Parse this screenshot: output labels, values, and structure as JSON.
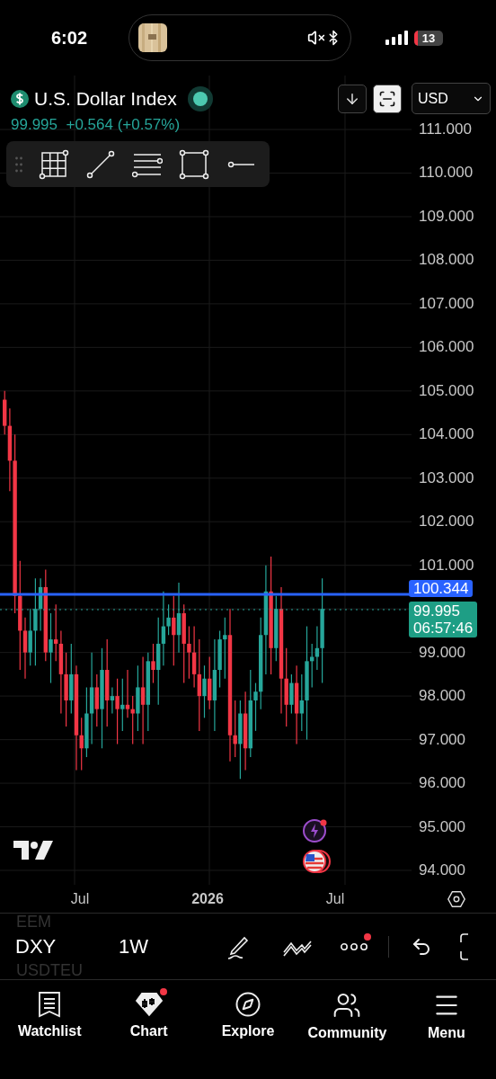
{
  "status_bar": {
    "time": "6:02",
    "battery": "13"
  },
  "header": {
    "title": "U.S. Dollar Index",
    "market_open": true,
    "price": "99.995",
    "change": "+0.564 (+0.57%)",
    "currency": "USD"
  },
  "price_axis": {
    "upper": [
      "111.000",
      "110.000",
      "109.000",
      "108.000",
      "107.000",
      "106.000",
      "105.000",
      "104.000",
      "103.000",
      "102.000",
      "101.000"
    ],
    "lower": [
      "99.000",
      "98.000",
      "97.000",
      "96.000",
      "95.000",
      "94.000"
    ]
  },
  "alert_line": {
    "price": "100.344"
  },
  "last_price": {
    "price": "99.995",
    "countdown": "06:57:46"
  },
  "time_axis": [
    {
      "label": "Jul",
      "bold": false
    },
    {
      "label": "2026",
      "bold": true
    },
    {
      "label": "Jul",
      "bold": false
    }
  ],
  "bottom_toolbar": {
    "prev_symbol": "EEM",
    "symbol": "DXY",
    "interval": "1W",
    "next_symbol": "USDTEU",
    "more_badge": true
  },
  "tabs": [
    {
      "label": "Watchlist",
      "selected": false,
      "badge": false
    },
    {
      "label": "Chart",
      "selected": true,
      "badge": true
    },
    {
      "label": "Explore",
      "selected": false,
      "badge": false
    },
    {
      "label": "Community",
      "selected": false,
      "badge": false
    },
    {
      "label": "Menu",
      "selected": false,
      "badge": false
    }
  ]
}
